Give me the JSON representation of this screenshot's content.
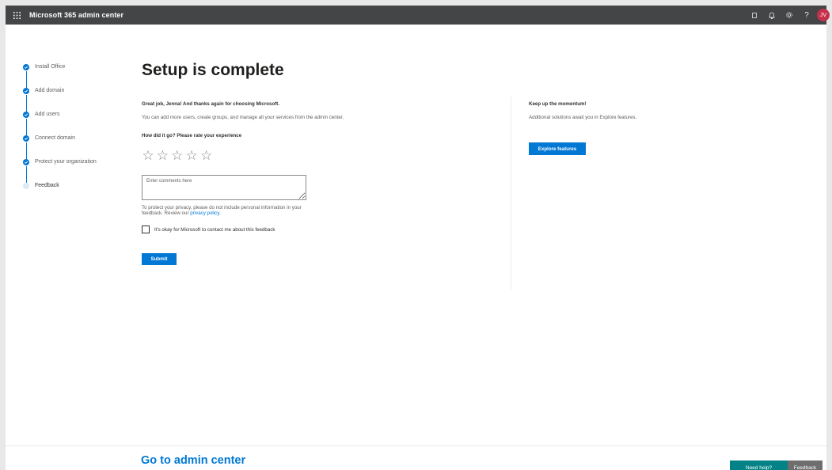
{
  "header": {
    "app_title": "Microsoft 365 admin center",
    "icons": [
      "app-launcher-icon",
      "window-icon",
      "bell-icon",
      "gear-icon",
      "help-icon"
    ],
    "help_glyph": "?",
    "avatar_initials": "JV"
  },
  "stepper": {
    "steps": [
      {
        "label": "Install Office",
        "status": "done"
      },
      {
        "label": "Add domain",
        "status": "done"
      },
      {
        "label": "Add users",
        "status": "done"
      },
      {
        "label": "Connect domain",
        "status": "done"
      },
      {
        "label": "Protect your organization",
        "status": "done"
      },
      {
        "label": "Feedback",
        "status": "current"
      }
    ]
  },
  "main": {
    "title": "Setup is complete",
    "greeting": "Great job, Jenna! And thanks again for choosing Microsoft.",
    "description": "You can add more users, create groups, and manage all your services from the admin center.",
    "rating_question": "How did it go? Please rate your experience",
    "rating": {
      "max": 5,
      "value": 0,
      "glyph": "☆"
    },
    "comment_placeholder": "Enter comments here",
    "privacy_text": "To protect your privacy, please do not include personal information in your feedback. Review our ",
    "privacy_link": "privacy policy.",
    "consent_label": "It's okay for Microsoft to contact me about this feedback",
    "submit_label": "Submit"
  },
  "side_panel": {
    "heading": "Keep up the momentum!",
    "description": "Additional solutions await you in Explore features.",
    "button_label": "Explore features"
  },
  "footer": {
    "go_admin_label": "Go to admin center",
    "need_help_label": "Need help?",
    "feedback_label": "Feedback"
  },
  "colors": {
    "accent": "#0078d4",
    "topbar": "#444546",
    "need_help": "#038387",
    "feedback_tab": "#6e6e6e",
    "avatar": "#c4314b"
  }
}
